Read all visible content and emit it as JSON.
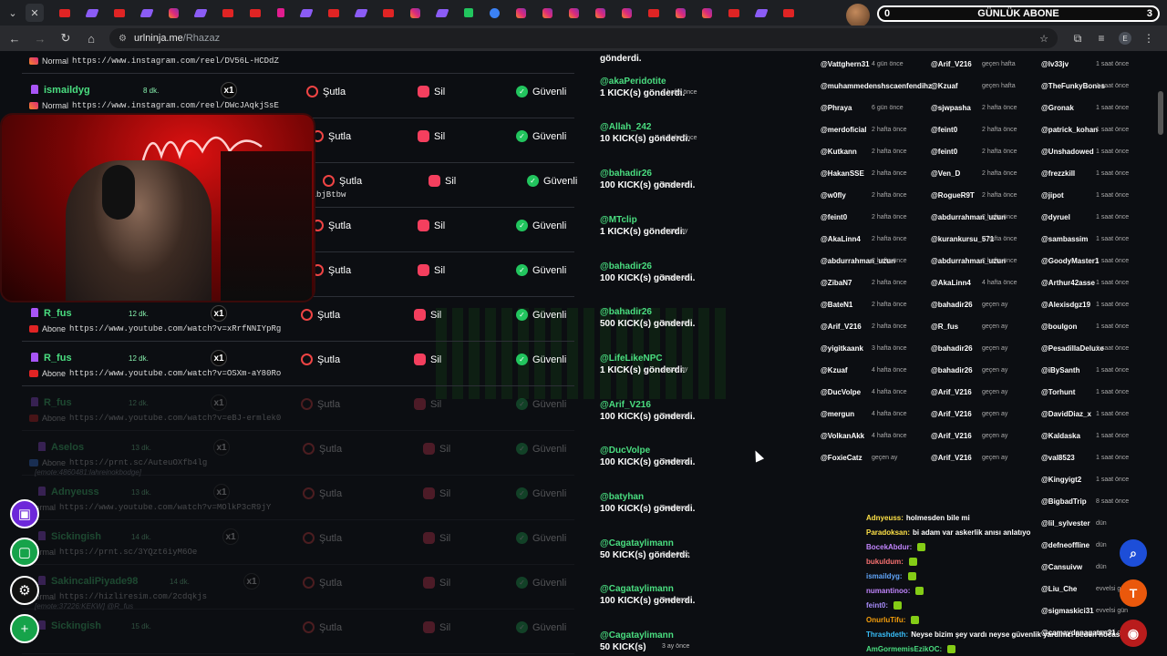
{
  "tabstrip": {
    "menu_icon": "chevron-down-icon",
    "close_icon": "close-icon",
    "tabs": [
      "yt",
      "tw",
      "yt",
      "tw",
      "ig",
      "tw",
      "yt",
      "yt",
      "h",
      "tw",
      "yt",
      "tw",
      "yt",
      "ig",
      "tw",
      "k",
      "b",
      "ig",
      "ig",
      "ig",
      "ig",
      "ig",
      "yt",
      "ig",
      "ig",
      "yt",
      "tw",
      "yt"
    ],
    "widget": {
      "title": "GÜNLÜK ABONE",
      "left_count": "0",
      "right_count": "3"
    }
  },
  "address_bar": {
    "host": "urlninja.me",
    "path": "/Rhazaz",
    "profile": "E"
  },
  "queue": {
    "actions": {
      "skip": "Şutla",
      "delete": "Sil",
      "safe": "Güvenli"
    },
    "rows": [
      {
        "user": "",
        "time": "",
        "count": "",
        "type_label": "Normal",
        "icon": "ig",
        "url": "https://www.instagram.com/reel/DV56L-HCDdZ",
        "dim": false,
        "partial": true
      },
      {
        "user": "ismaildyg",
        "time": "8 dk.",
        "count": "x1",
        "type_label": "Normal",
        "icon": "ig",
        "url": "https://www.instagram.com/reel/DWcJAqkjSsE",
        "dim": false
      },
      {
        "user": "",
        "time": "",
        "count": "",
        "type_label": "",
        "icon": "",
        "url": "",
        "dim": false,
        "hidden_left": true
      },
      {
        "user": "",
        "time": "",
        "count": "",
        "type_label": "",
        "icon": "",
        "url": "zeTlibjBtbw",
        "dim": false,
        "hidden_left": true
      },
      {
        "user": "",
        "time": "",
        "count": "",
        "type_label": "",
        "icon": "",
        "url": "",
        "dim": false,
        "hidden_left": true
      },
      {
        "user": "",
        "time": "",
        "count": "",
        "type_label": "",
        "icon": "",
        "url": "",
        "dim": false,
        "hidden_left": true
      },
      {
        "user": "R_fus",
        "time": "12 dk.",
        "count": "x1",
        "type_label": "Abone",
        "icon": "yt",
        "url": "https://www.youtube.com/watch?v=xRrfNNIYpRg",
        "dim": false
      },
      {
        "user": "R_fus",
        "time": "12 dk.",
        "count": "x1",
        "type_label": "Abone",
        "icon": "yt",
        "url": "https://www.youtube.com/watch?v=OSXm-aY80Ro",
        "dim": false
      },
      {
        "user": "R_fus",
        "time": "12 dk.",
        "count": "x1",
        "type_label": "Abone",
        "icon": "yt",
        "url": "https://www.youtube.com/watch?v=eBJ-ermlek0",
        "dim": true
      },
      {
        "user": "Aselos",
        "time": "13 dk.",
        "count": "x1",
        "type_label": "Abone",
        "icon": "pr",
        "url": "https://prnt.sc/AuteuOXfb4lg",
        "note": "[emote:4860481:lahreinokbodge]",
        "dim": true
      },
      {
        "user": "Adnyeuss",
        "time": "13 dk.",
        "count": "x1",
        "type_label": "Normal",
        "icon": "",
        "url": "https://www.youtube.com/watch?v=MOlkP3cR9jY",
        "dim": true
      },
      {
        "user": "Sickingish",
        "time": "14 dk.",
        "count": "x1",
        "type_label": "Normal",
        "icon": "",
        "url": "https://prnt.sc/3YQzt6iyM6Oe",
        "dim": true
      },
      {
        "user": "SakincaliPiyade98",
        "time": "14 dk.",
        "count": "x1",
        "type_label": "Normal",
        "icon": "",
        "url": "https://hizliresim.com/2cdqkjs",
        "note": "[emote:37226:KEKW] @R_fus",
        "dim": true
      },
      {
        "user": "Sickingish",
        "time": "15 dk.",
        "count": "",
        "type_label": "",
        "icon": "",
        "url": "",
        "dim": true
      }
    ]
  },
  "kicks": [
    {
      "user": "",
      "text": "gönderdi.",
      "time": ""
    },
    {
      "user": "@akaPeridotite",
      "text": "1 KICK(s) gönderdi.",
      "time": "2 hafta önce"
    },
    {
      "user": "@Allah_242",
      "text": "10 KICK(s) gönderdi.",
      "time": "2 hafta önce"
    },
    {
      "user": "@bahadir26",
      "text": "100 KICK(s) gönderdi.",
      "time": "geçen ay"
    },
    {
      "user": "@MTclip",
      "text": "1 KICK(s) gönderdi.",
      "time": "geçen ay"
    },
    {
      "user": "@bahadir26",
      "text": "100 KICK(s) gönderdi.",
      "time": "geçen ay"
    },
    {
      "user": "@bahadir26",
      "text": "500 KICK(s) gönderdi.",
      "time": "geçen ay"
    },
    {
      "user": "@LifeLikeNPC",
      "text": "1 KICK(s) gönderdi.",
      "time": "geçen ay"
    },
    {
      "user": "@Arif_V216",
      "text": "100 KICK(s) gönderdi.",
      "time": "2 ay önce"
    },
    {
      "user": "@DucVolpe",
      "text": "100 KICK(s) gönderdi.",
      "time": "2 ay önce"
    },
    {
      "user": "@batyhan",
      "text": "100 KICK(s) gönderdi.",
      "time": "3 ay önce"
    },
    {
      "user": "@Cagataylimann",
      "text": "50 KICK(s) gönderdi.",
      "time": "3 ay önce"
    },
    {
      "user": "@Cagataylimann",
      "text": "100 KICK(s) gönderdi.",
      "time": "3 ay önce"
    },
    {
      "user": "@Cagataylimann",
      "text": "50 KICK(s)",
      "time": "3 ay önce"
    }
  ],
  "board": {
    "col1": [
      [
        "@Vattghern31",
        "4 gün önce"
      ],
      [
        "@muhammedenshscaenfendihz",
        ""
      ],
      [
        "@Phraya",
        "6 gün önce"
      ],
      [
        "@merdoficial",
        "2 hafta önce"
      ],
      [
        "@Kutkann",
        "2 hafta önce"
      ],
      [
        "@HakanSSE",
        "2 hafta önce"
      ],
      [
        "@w0fly",
        "2 hafta önce"
      ],
      [
        "@feint0",
        "2 hafta önce"
      ],
      [
        "@AkaLinn4",
        "2 hafta önce"
      ],
      [
        "@abdurrahman_uzun",
        "2 hafta önce"
      ],
      [
        "@ZibaN7",
        "2 hafta önce"
      ],
      [
        "@BateN1",
        "2 hafta önce"
      ],
      [
        "@Arif_V216",
        "2 hafta önce"
      ],
      [
        "@yigitkaank",
        "3 hafta önce"
      ],
      [
        "@Kzuaf",
        "4 hafta önce"
      ],
      [
        "@DucVolpe",
        "4 hafta önce"
      ],
      [
        "@mergun",
        "4 hafta önce"
      ],
      [
        "@VolkanAkk",
        "4 hafta önce"
      ],
      [
        "@FoxieCatz",
        "geçen ay"
      ]
    ],
    "col2": [
      [
        "@Arif_V216",
        "geçen hafta"
      ],
      [
        "@Kzuaf",
        "geçen hafta"
      ],
      [
        "@sjwpasha",
        "2 hafta önce"
      ],
      [
        "@feint0",
        "2 hafta önce"
      ],
      [
        "@feint0",
        "2 hafta önce"
      ],
      [
        "@Ven_D",
        "2 hafta önce"
      ],
      [
        "@RogueR9T",
        "2 hafta önce"
      ],
      [
        "@abdurrahman_uzun",
        "2 hafta önce"
      ],
      [
        "@kurankursu_571",
        "2 hafta önce"
      ],
      [
        "@abdurrahman_uzun",
        "2 hafta önce"
      ],
      [
        "@AkaLinn4",
        "4 hafta önce"
      ],
      [
        "@bahadir26",
        "geçen ay"
      ],
      [
        "@R_fus",
        "geçen ay"
      ],
      [
        "@bahadir26",
        "geçen ay"
      ],
      [
        "@bahadir26",
        "geçen ay"
      ],
      [
        "@Arif_V216",
        "geçen ay"
      ],
      [
        "@Arif_V216",
        "geçen ay"
      ],
      [
        "@Arif_V216",
        "geçen ay"
      ],
      [
        "@Arif_V216",
        "geçen ay"
      ]
    ],
    "col3": [
      [
        "@lv33jv",
        "1 saat önce"
      ],
      [
        "@TheFunkyBones",
        "1 saat önce"
      ],
      [
        "@Gronak",
        "1 saat önce"
      ],
      [
        "@patrick_kohan",
        "1 saat önce"
      ],
      [
        "@Unshadowed",
        "1 saat önce"
      ],
      [
        "@frezzkill",
        "1 saat önce"
      ],
      [
        "@jipot",
        "1 saat önce"
      ],
      [
        "@dyruel",
        "1 saat önce"
      ],
      [
        "@sambassim",
        "1 saat önce"
      ],
      [
        "@GoodyMaster1",
        "1 saat önce"
      ],
      [
        "@Arthur42asse",
        "1 saat önce"
      ],
      [
        "@Alexisdgz19",
        "1 saat önce"
      ],
      [
        "@boulgon",
        "1 saat önce"
      ],
      [
        "@PesadillaDeluxe",
        "1 saat önce"
      ],
      [
        "@iBySanth",
        "1 saat önce"
      ],
      [
        "@Torhunt",
        "1 saat önce"
      ],
      [
        "@DavidDiaz_x",
        "1 saat önce"
      ],
      [
        "@Kaldaska",
        "1 saat önce"
      ],
      [
        "@val8523",
        "1 saat önce"
      ],
      [
        "@Kingyigt2",
        "1 saat önce"
      ],
      [
        "@BigbadTrip",
        "8 saat önce"
      ],
      [
        "@lil_sylvester",
        "dün"
      ],
      [
        "@defneoffline",
        "dün"
      ],
      [
        "@Cansuivw",
        "dün"
      ],
      [
        "@Liu_Che",
        "evvelsi gün"
      ],
      [
        "@sigmaskici31",
        "evvelsi gün"
      ],
      [
        "@camaydanagatan31",
        "evvelsi gün"
      ]
    ]
  },
  "chat": [
    {
      "name": "Adnyeuss:",
      "color": "#fde047",
      "msg": "holmesden bile mi",
      "emote": false
    },
    {
      "name": "Paradoksan:",
      "color": "#fde047",
      "msg": "bi adam var askerlik anısı anlatıyo",
      "emote": false
    },
    {
      "name": "BocekAbdur:",
      "color": "#c084fc",
      "msg": "",
      "emote": true
    },
    {
      "name": "bukuldum:",
      "color": "#f87171",
      "msg": "",
      "emote": true
    },
    {
      "name": "ismaildyg:",
      "color": "#60a5fa",
      "msg": "",
      "emote": true
    },
    {
      "name": "numantinoo:",
      "color": "#c084fc",
      "msg": "",
      "emote": true
    },
    {
      "name": "feint0:",
      "color": "#a78bfa",
      "msg": "",
      "emote": true
    },
    {
      "name": "OnurluTifu:",
      "color": "#f59e0b",
      "msg": "",
      "emote": true
    },
    {
      "name": "Thrashdeth:",
      "color": "#38bdf8",
      "msg": "Neyse bizim şey vardı neyse güvenlik yardımcı beden hocası",
      "emote": false
    },
    {
      "name": "AmGormemisEzikOC:",
      "color": "#4ade80",
      "msg": "",
      "emote": true
    }
  ],
  "dock": [
    {
      "name": "twitch-icon",
      "glyph": "▣",
      "bg": "#6d28d9"
    },
    {
      "name": "kick-icon",
      "glyph": "▢",
      "bg": "#16a34a"
    },
    {
      "name": "settings-icon",
      "glyph": "⚙",
      "bg": "#111"
    },
    {
      "name": "add-user-icon",
      "glyph": "+",
      "bg": "#16a34a"
    }
  ],
  "fabs": [
    {
      "name": "search-icon",
      "glyph": "⌕",
      "bg": "#1d4ed8"
    },
    {
      "name": "tip-icon",
      "glyph": "T",
      "bg": "#ea580c"
    },
    {
      "name": "record-icon",
      "glyph": "◉",
      "bg": "#b91c1c"
    }
  ]
}
